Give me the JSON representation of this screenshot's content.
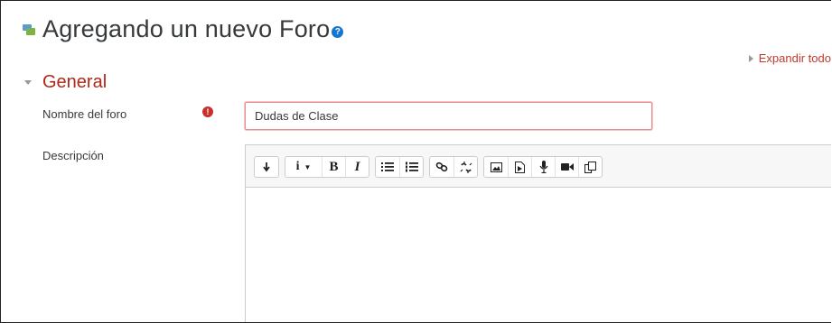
{
  "header": {
    "title": "Agregando un nuevo Foro"
  },
  "links": {
    "expand_all": "Expandir todo"
  },
  "section": {
    "general": "General"
  },
  "form": {
    "forum_name_label": "Nombre del foro",
    "forum_name_value": "Dudas de Clase",
    "description_label": "Descripción"
  },
  "toolbar": {
    "buttons": [
      {
        "icon": "toolbar-toggle-icon",
        "text": "↴"
      },
      {
        "icon": "info-dropdown-icon",
        "text": "i ▾"
      },
      {
        "icon": "bold-icon",
        "text": "B"
      },
      {
        "icon": "italic-icon",
        "text": "I"
      },
      {
        "icon": "unordered-list-icon"
      },
      {
        "icon": "ordered-list-icon"
      },
      {
        "icon": "link-icon"
      },
      {
        "icon": "unlink-icon"
      },
      {
        "icon": "image-icon"
      },
      {
        "icon": "media-icon"
      },
      {
        "icon": "record-audio-icon"
      },
      {
        "icon": "record-video-icon"
      },
      {
        "icon": "manage-files-icon"
      }
    ]
  },
  "colors": {
    "section_title": "#b0281a",
    "link": "#c0392b",
    "required": "#c9302c",
    "help": "#1177d1",
    "input_error_border": "#e78f8f"
  }
}
